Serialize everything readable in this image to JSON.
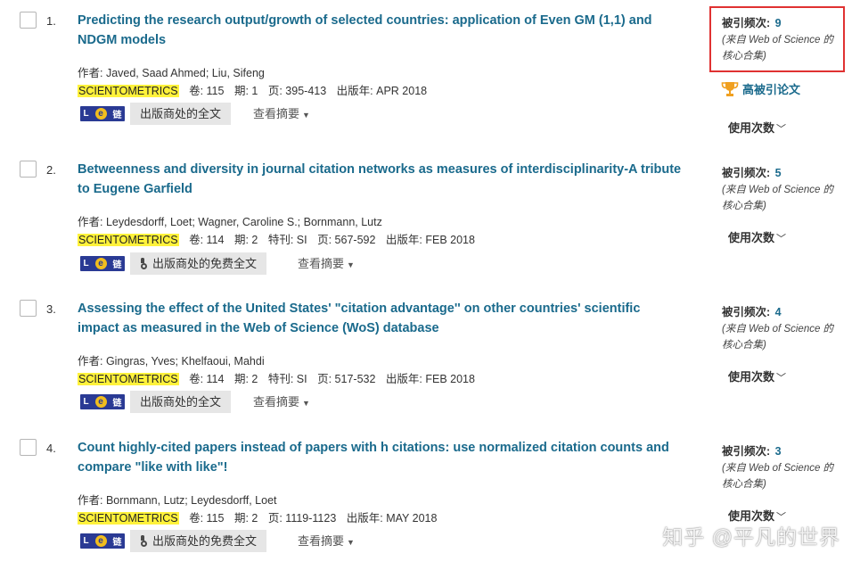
{
  "labels": {
    "authors_prefix": "作者: ",
    "volume": "卷: ",
    "issue": "期: ",
    "special": "特刊: ",
    "pages": "页: ",
    "year": "出版年: ",
    "times_cited": "被引频次: ",
    "wos_source": "(来自 Web of Science 的核心合集)",
    "usage": "使用次数",
    "publisher_fulltext": "出版商处的全文",
    "publisher_free_fulltext": "出版商处的免费全文",
    "view_abstract": "查看摘要",
    "highly_cited": "高被引论文",
    "lnk_logo": "链"
  },
  "records": [
    {
      "num": "1.",
      "title": "Predicting the research output/growth of selected countries: application of Even GM (1,1) and NDGM models",
      "authors": "Javed, Saad Ahmed; Liu, Sifeng",
      "journal": "SCIENTOMETRICS",
      "volume": "115",
      "issue": "1",
      "special": "",
      "pages": "395-413",
      "year": "APR 2018",
      "times_cited": "9",
      "fulltext_type": "publisher",
      "highly_cited": true
    },
    {
      "num": "2.",
      "title": "Betweenness and diversity in journal citation networks as measures of interdisciplinarity-A tribute to Eugene Garfield",
      "authors": "Leydesdorff, Loet; Wagner, Caroline S.; Bornmann, Lutz",
      "journal": "SCIENTOMETRICS",
      "volume": "114",
      "issue": "2",
      "special": "SI",
      "pages": "567-592",
      "year": "FEB 2018",
      "times_cited": "5",
      "fulltext_type": "free",
      "highly_cited": false
    },
    {
      "num": "3.",
      "title": "Assessing the effect of the United States' \"citation advantage'' on other countries' scientific impact as measured in the Web of Science (WoS) database",
      "authors": "Gingras, Yves; Khelfaoui, Mahdi",
      "journal": "SCIENTOMETRICS",
      "volume": "114",
      "issue": "2",
      "special": "SI",
      "pages": "517-532",
      "year": "FEB 2018",
      "times_cited": "4",
      "fulltext_type": "publisher",
      "highly_cited": false
    },
    {
      "num": "4.",
      "title": "Count highly-cited papers instead of papers with h citations: use normalized citation counts and compare \"like with like\"!",
      "authors": "Bornmann, Lutz; Leydesdorff, Loet",
      "journal": "SCIENTOMETRICS",
      "volume": "115",
      "issue": "2",
      "special": "",
      "pages": "1119-1123",
      "year": "MAY 2018",
      "times_cited": "3",
      "fulltext_type": "free",
      "highly_cited": false
    }
  ],
  "watermark": "知乎 @平凡的世界",
  "colors": {
    "title_link": "#1a6a8c",
    "journal_highlight": "#fff23b",
    "highlight_box": "#e03232",
    "trophy": "#f0a020"
  }
}
